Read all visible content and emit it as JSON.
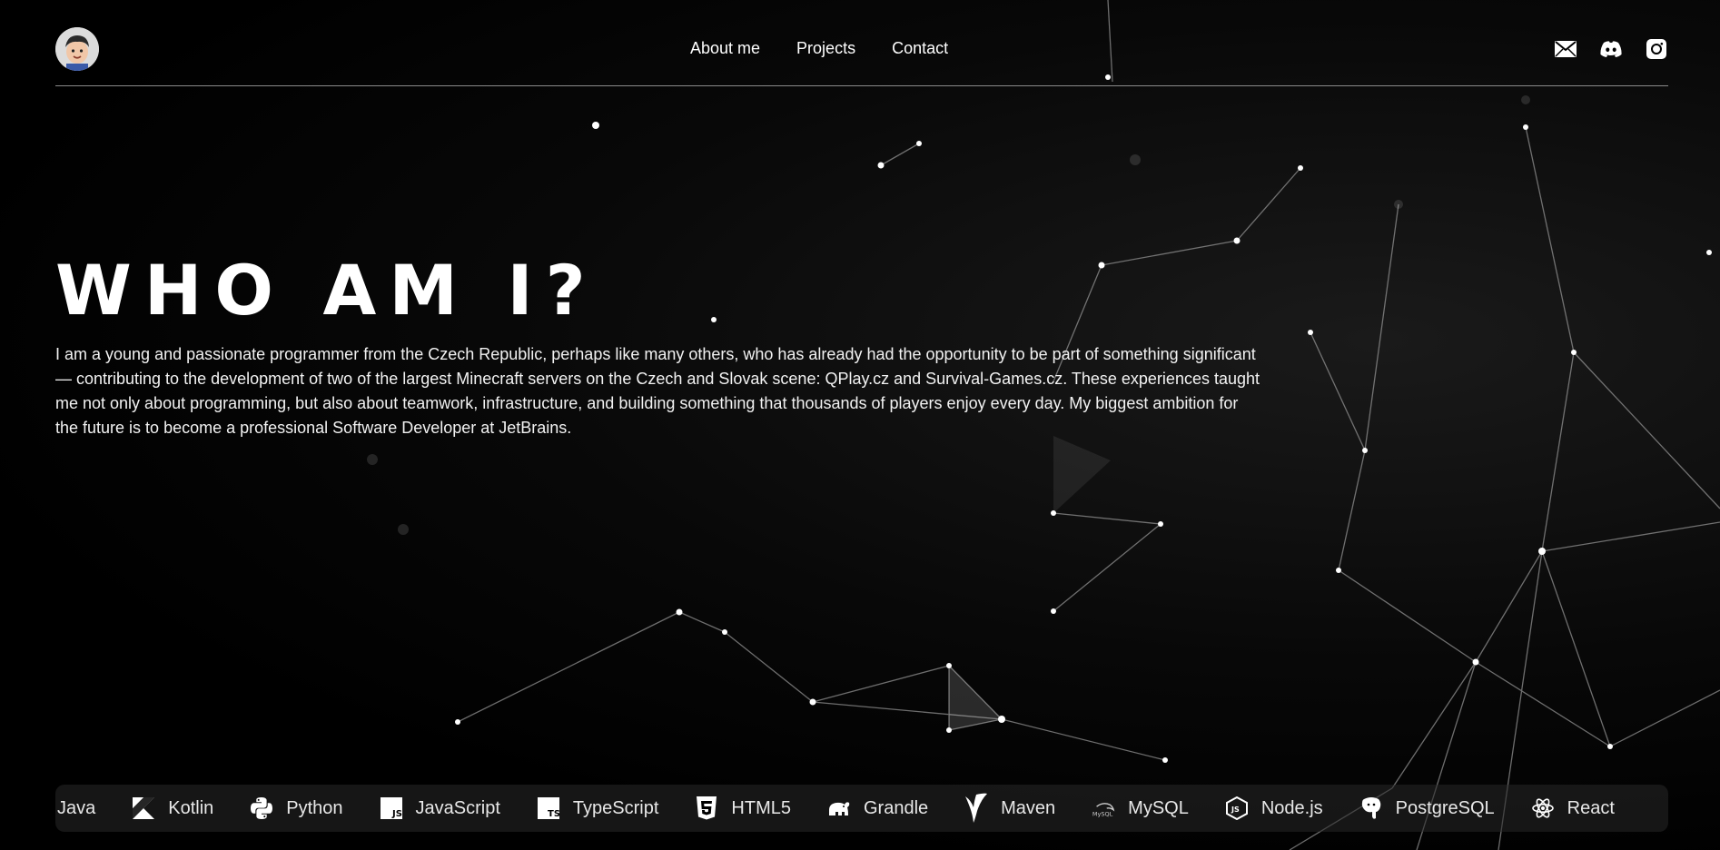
{
  "header": {
    "nav": [
      {
        "label": "About me"
      },
      {
        "label": "Projects"
      },
      {
        "label": "Contact"
      }
    ],
    "socials": [
      "mail-icon",
      "discord-icon",
      "instagram-icon"
    ]
  },
  "hero": {
    "title": "WHO AM I?",
    "text": "I am a young and passionate programmer from the Czech Republic, perhaps like many others, who has already had the opportunity to be part of something significant — contributing to the development of two of the largest Minecraft servers on the Czech and Slovak scene: QPlay.cz and Survival-Games.cz. These experiences taught me not only about programming, but also about teamwork, infrastructure, and building something that thousands of players enjoy every day. My biggest ambition for the future is to become a professional Software Developer at JetBrains."
  },
  "tech": {
    "items": [
      {
        "label": "Java",
        "icon": "java-icon"
      },
      {
        "label": "Kotlin",
        "icon": "kotlin-icon"
      },
      {
        "label": "Python",
        "icon": "python-icon"
      },
      {
        "label": "JavaScript",
        "icon": "javascript-icon"
      },
      {
        "label": "TypeScript",
        "icon": "typescript-icon"
      },
      {
        "label": "HTML5",
        "icon": "html5-icon"
      },
      {
        "label": "Grandle",
        "icon": "gradle-icon"
      },
      {
        "label": "Maven",
        "icon": "maven-icon"
      },
      {
        "label": "MySQL",
        "icon": "mysql-icon"
      },
      {
        "label": "Node.js",
        "icon": "nodejs-icon"
      },
      {
        "label": "PostgreSQL",
        "icon": "postgresql-icon"
      },
      {
        "label": "React",
        "icon": "react-icon"
      }
    ]
  }
}
